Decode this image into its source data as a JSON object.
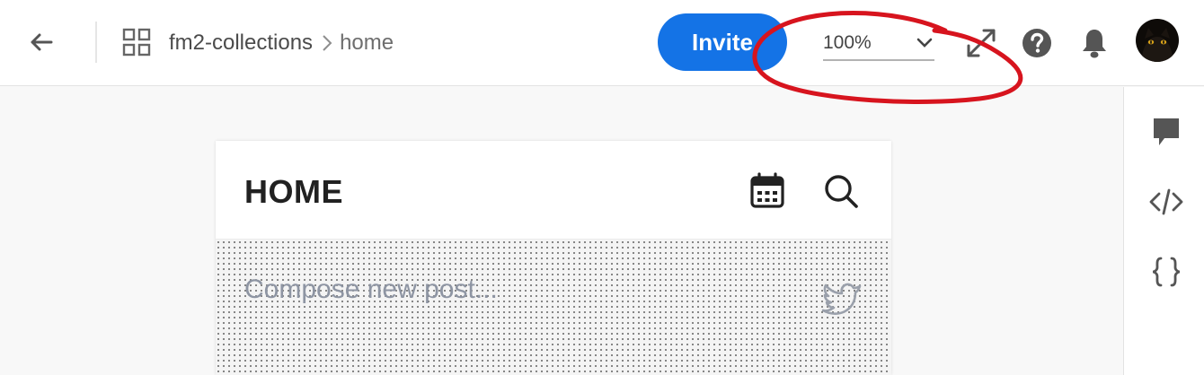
{
  "header": {
    "breadcrumb": {
      "project": "fm2-collections",
      "page": "home"
    },
    "invite_label": "Invite",
    "zoom": {
      "value": "100%"
    },
    "icons": {
      "back": "arrow-left-icon",
      "grid": "grid-icon",
      "expand": "expand-icon",
      "help": "help-icon",
      "bell": "bell-icon"
    },
    "accent_color": "#1473e6"
  },
  "annotation": {
    "color": "#d7141e"
  },
  "right_panel": {
    "icons": [
      "comment-icon",
      "code-icon",
      "braces-icon"
    ]
  },
  "artboard": {
    "title": "HOME",
    "compose_placeholder": "Compose new post...",
    "icons": {
      "calendar": "calendar-icon",
      "search": "search-icon",
      "bird": "twitter-bird-icon"
    }
  }
}
